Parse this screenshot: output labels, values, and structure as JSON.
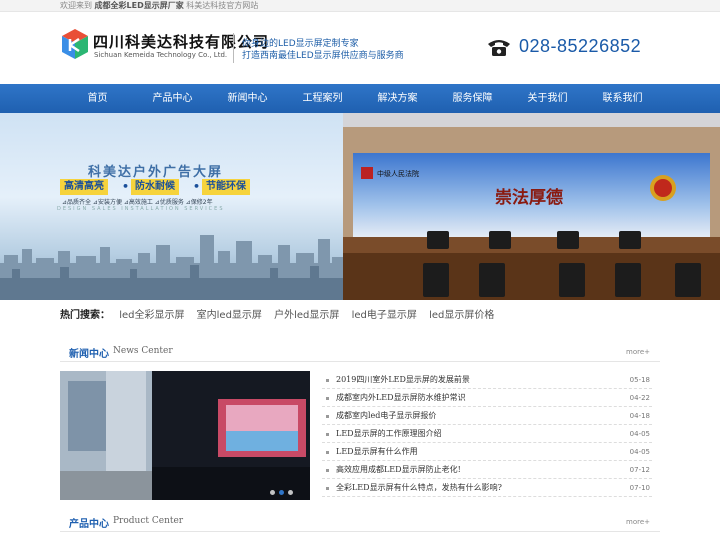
{
  "topbar": {
    "prefix": "欢迎来到",
    "highlight": "成都全彩LED显示屏厂家",
    "suffix": "科美达科技官方网站"
  },
  "header": {
    "company_cn": "四川科美达科技有限公司",
    "company_en": "Sichuan Kemeida Technology Co., Ltd.",
    "slogan_1": "你身边的LED显示屏定制专家",
    "slogan_2": "打造西南最佳LED显示屏供应商与服务商",
    "phone": "028-85226852"
  },
  "nav": [
    "首页",
    "产品中心",
    "新闻中心",
    "工程案列",
    "解决方案",
    "服务保障",
    "关于我们",
    "联系我们"
  ],
  "banner": {
    "title": "科美达户外广告大屏",
    "tags": [
      "高清高亮",
      "防水耐候",
      "节能环保"
    ],
    "features": "⊿品质齐全  ⊿安装方便  ⊿高效施工  ⊿优质服务  ⊿保修2年",
    "features_en": "DESIGN  SALES  INSTALLATION  SERVICES",
    "right_screen_text": "崇法厚德",
    "right_plaque": "中级人民法院",
    "slide_count": 3,
    "active_slide": 2
  },
  "hot_search": {
    "label": "热门搜索：",
    "links": [
      "led全彩显示屏",
      "室内led显示屏",
      "户外led显示屏",
      "led电子显示屏",
      "led显示屏价格"
    ]
  },
  "news": {
    "title_cn": "新闻中心",
    "title_en": "News Center",
    "more": "more+",
    "items": [
      {
        "title": "2019四川室外LED显示屏的发展前景",
        "date": "05-18"
      },
      {
        "title": "成都室内外LED显示屏防水维护常识",
        "date": "04-22"
      },
      {
        "title": "成都室内led电子显示屏报价",
        "date": "04-18"
      },
      {
        "title": "LED显示屏的工作原理图介绍",
        "date": "04-05"
      },
      {
        "title": "LED显示屏有什么作用",
        "date": "04-05"
      },
      {
        "title": "高效应用成都LED显示屏防止老化!",
        "date": "07-12"
      },
      {
        "title": "全彩LED显示屏有什么特点，发热有什么影响?",
        "date": "07-10"
      }
    ]
  },
  "products": {
    "title_cn": "产品中心",
    "title_en": "Product Center",
    "more": "more+"
  }
}
